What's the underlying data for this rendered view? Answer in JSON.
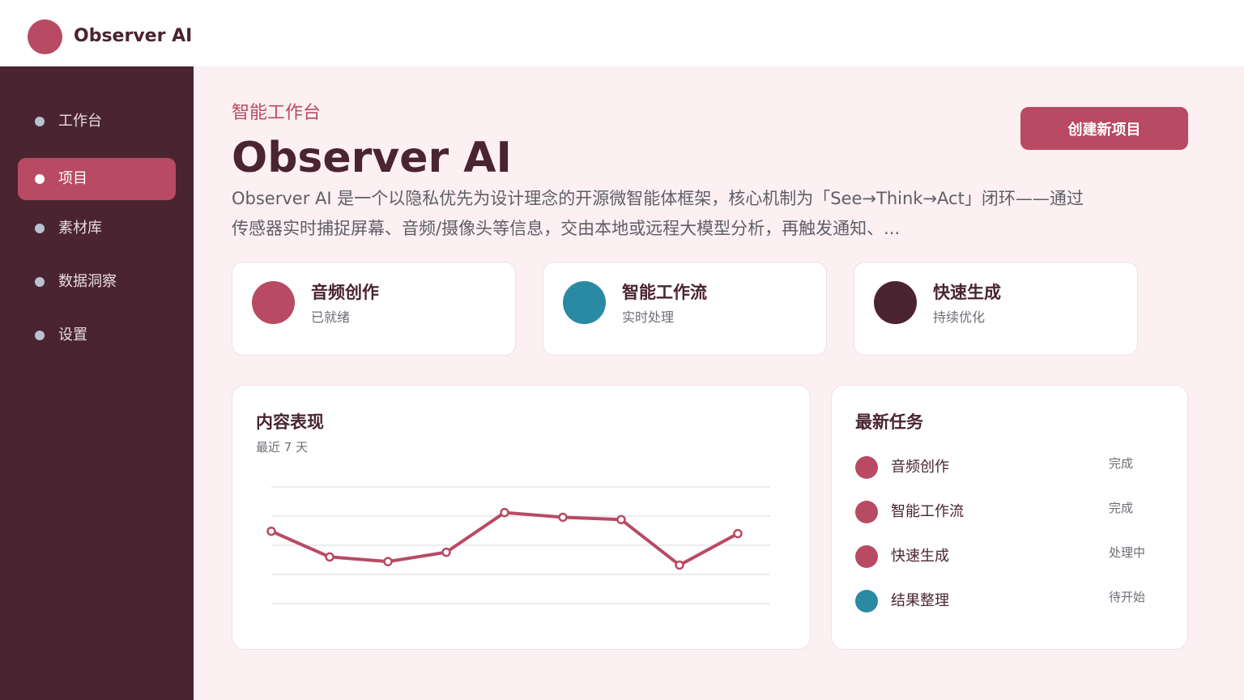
{
  "app": {
    "name": "Observer AI"
  },
  "sidebar": {
    "items": [
      {
        "label": "工作台",
        "active": false
      },
      {
        "label": "项目",
        "active": true
      },
      {
        "label": "素材库",
        "active": false
      },
      {
        "label": "数据洞察",
        "active": false
      },
      {
        "label": "设置",
        "active": false
      }
    ]
  },
  "hero": {
    "eyebrow": "智能工作台",
    "title": "Observer AI",
    "description": "Observer AI 是一个以隐私优先为设计理念的开源微智能体框架，核心机制为「See→Think→Act」闭环——通过传感器实时捕捉屏幕、音频/摄像头等信息，交由本地或远程大模型分析，再触发通知、...",
    "create_button": "创建新项目"
  },
  "stats": [
    {
      "title": "音频创作",
      "subtitle": "已就绪",
      "color": "#b94a63"
    },
    {
      "title": "智能工作流",
      "subtitle": "实时处理",
      "color": "#2a8aa3"
    },
    {
      "title": "快速生成",
      "subtitle": "持续优化",
      "color": "#4a2430"
    }
  ],
  "performance": {
    "title": "内容表现",
    "subtitle": "最近 7 天"
  },
  "chart_data": {
    "type": "line",
    "values": [
      62,
      40,
      36,
      44,
      78,
      74,
      72,
      33,
      60
    ],
    "ylim": [
      0,
      100
    ],
    "grid": true,
    "color": "#b94a63"
  },
  "tasks": {
    "title": "最新任务",
    "items": [
      {
        "label": "音频创作",
        "status": "完成",
        "color": "#b94a63"
      },
      {
        "label": "智能工作流",
        "status": "完成",
        "color": "#b94a63"
      },
      {
        "label": "快速生成",
        "status": "处理中",
        "color": "#b94a63"
      },
      {
        "label": "结果整理",
        "status": "待开始",
        "color": "#2a8aa3"
      }
    ]
  }
}
